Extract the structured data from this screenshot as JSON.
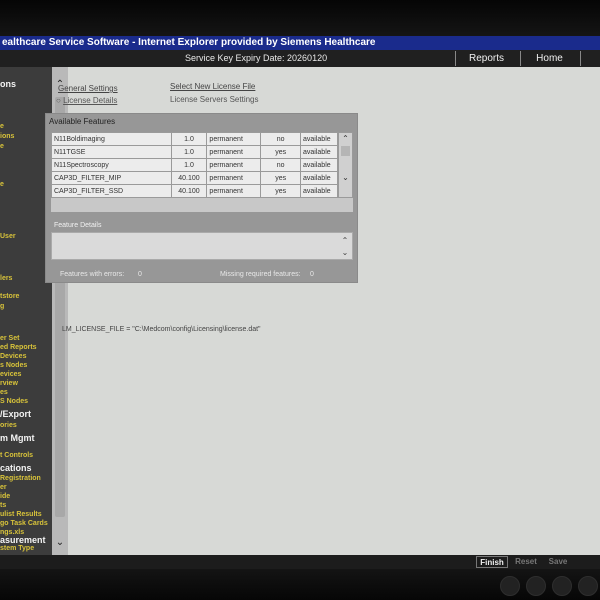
{
  "window": {
    "title": "ealthcare Service Software - Internet Explorer provided by Siemens Healthcare"
  },
  "topbar": {
    "expiry": "Service Key Expiry Date: 20260120",
    "reports": "Reports",
    "home": "Home"
  },
  "sidebar": {
    "items": [
      {
        "label": "ons",
        "head": true
      },
      {
        "label": "e"
      },
      {
        "label": "ions"
      },
      {
        "label": "e"
      },
      {
        "label": "e"
      },
      {
        "label": "User"
      },
      {
        "label": "lers"
      },
      {
        "label": "tstore"
      },
      {
        "label": "g"
      },
      {
        "label": "er Set"
      },
      {
        "label": "ed Reports"
      },
      {
        "label": "Devices"
      },
      {
        "label": "s Nodes"
      },
      {
        "label": "evices"
      },
      {
        "label": "rview"
      },
      {
        "label": "es"
      },
      {
        "label": "S Nodes"
      },
      {
        "label": "/Export",
        "head": true
      },
      {
        "label": "ories"
      },
      {
        "label": "m Mgmt",
        "head": true
      },
      {
        "label": "t Controls"
      },
      {
        "label": "cations",
        "head": true
      },
      {
        "label": "Registration"
      },
      {
        "label": "er"
      },
      {
        "label": "ide"
      },
      {
        "label": "ts"
      },
      {
        "label": "ulist Results"
      },
      {
        "label": "go Task Cards"
      },
      {
        "label": "ngs.xls"
      },
      {
        "label": "asurement",
        "head": true
      },
      {
        "label": "stem Type"
      }
    ]
  },
  "main": {
    "links": {
      "general_settings": "General Settings",
      "select_new_license": "Select New License File",
      "license_details": "License Details",
      "license_servers": "License Servers Settings"
    },
    "features": {
      "title": "Available Features",
      "rows": [
        [
          "N11Boldimaging",
          "1.0",
          "permanent",
          "no",
          "available"
        ],
        [
          "N11TGSE",
          "1.0",
          "permanent",
          "yes",
          "available"
        ],
        [
          "N11Spectroscopy",
          "1.0",
          "permanent",
          "no",
          "available"
        ],
        [
          "CAP3D_FILTER_MIP",
          "40.100",
          "permanent",
          "yes",
          "available"
        ],
        [
          "CAP3D_FILTER_SSD",
          "40.100",
          "permanent",
          "yes",
          "available"
        ]
      ]
    },
    "details_title": "Feature Details",
    "errors_label": "Features with errors:",
    "errors_count": "0",
    "missing_label": "Missing required features:",
    "missing_count": "0",
    "lm_path": "LM_LICENSE_FILE = \"C:\\Medcom\\config\\Licensing\\license.dat\""
  },
  "bottom": {
    "finish": "Finish",
    "reset": "Reset",
    "save": "Save"
  },
  "icons": {
    "scroll_up": "scroll-up-icon",
    "scroll_down": "scroll-down-icon",
    "radio": "radio-icon"
  }
}
